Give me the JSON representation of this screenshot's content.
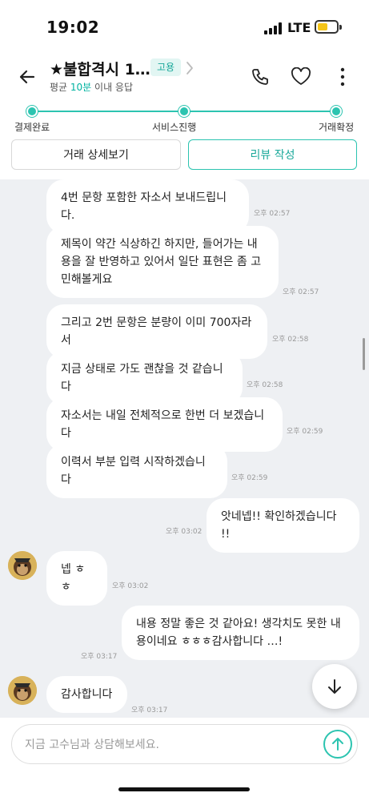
{
  "status_bar": {
    "time": "19:02",
    "network": "LTE"
  },
  "header": {
    "title": "★불합격시 1…",
    "tag": "고용",
    "subtitle_prefix": "평균 ",
    "subtitle_highlight": "10분",
    "subtitle_suffix": " 이내 응답",
    "accent_color": "#2cc4b0"
  },
  "progress": {
    "steps": [
      "결제완료",
      "서비스진행",
      "거래확정"
    ],
    "level": 1.0
  },
  "actions": {
    "detail_label": "거래 상세보기",
    "review_label": "리뷰 작성"
  },
  "messages": [
    {
      "side": "left",
      "text": "4번 문항 포함한 자소서 보내드립니다.",
      "time": "오후 02:57"
    },
    {
      "side": "left",
      "text": "제목이 약간 식상하긴 하지만, 들어가는 내용을 잘 반영하고 있어서 일단 표현은 좀 고민해볼게요",
      "time": "오후 02:57"
    },
    {
      "side": "left",
      "text": "그리고 2번 문항은 분량이 이미 700자라서",
      "time": "오후 02:58"
    },
    {
      "side": "left",
      "text": "지금 상태로 가도 괜찮을 것 같습니다",
      "time": "오후 02:58"
    },
    {
      "side": "left",
      "text": "자소서는 내일 전체적으로 한번 더 보겠습니다",
      "time": "오후 02:59"
    },
    {
      "side": "left",
      "text": "이력서 부분 입력 시작하겠습니다",
      "time": "오후 02:59"
    },
    {
      "side": "right",
      "text": "앗네넵!! 확인하겠습니다 !!",
      "time": "오후 03:02"
    },
    {
      "side": "left",
      "text": "넵 ㅎㅎ",
      "time": "오후 03:02"
    },
    {
      "side": "right",
      "text": "내용 정말 좋은 것 같아요! 생각치도 못한 내용이네요 ㅎㅎㅎ감사합니다 …!",
      "time": "오후 03:17"
    },
    {
      "side": "left",
      "text": "감사합니다",
      "time": "오후 03:17"
    }
  ],
  "input": {
    "placeholder": "지금 고수님과 상담해보세요."
  }
}
